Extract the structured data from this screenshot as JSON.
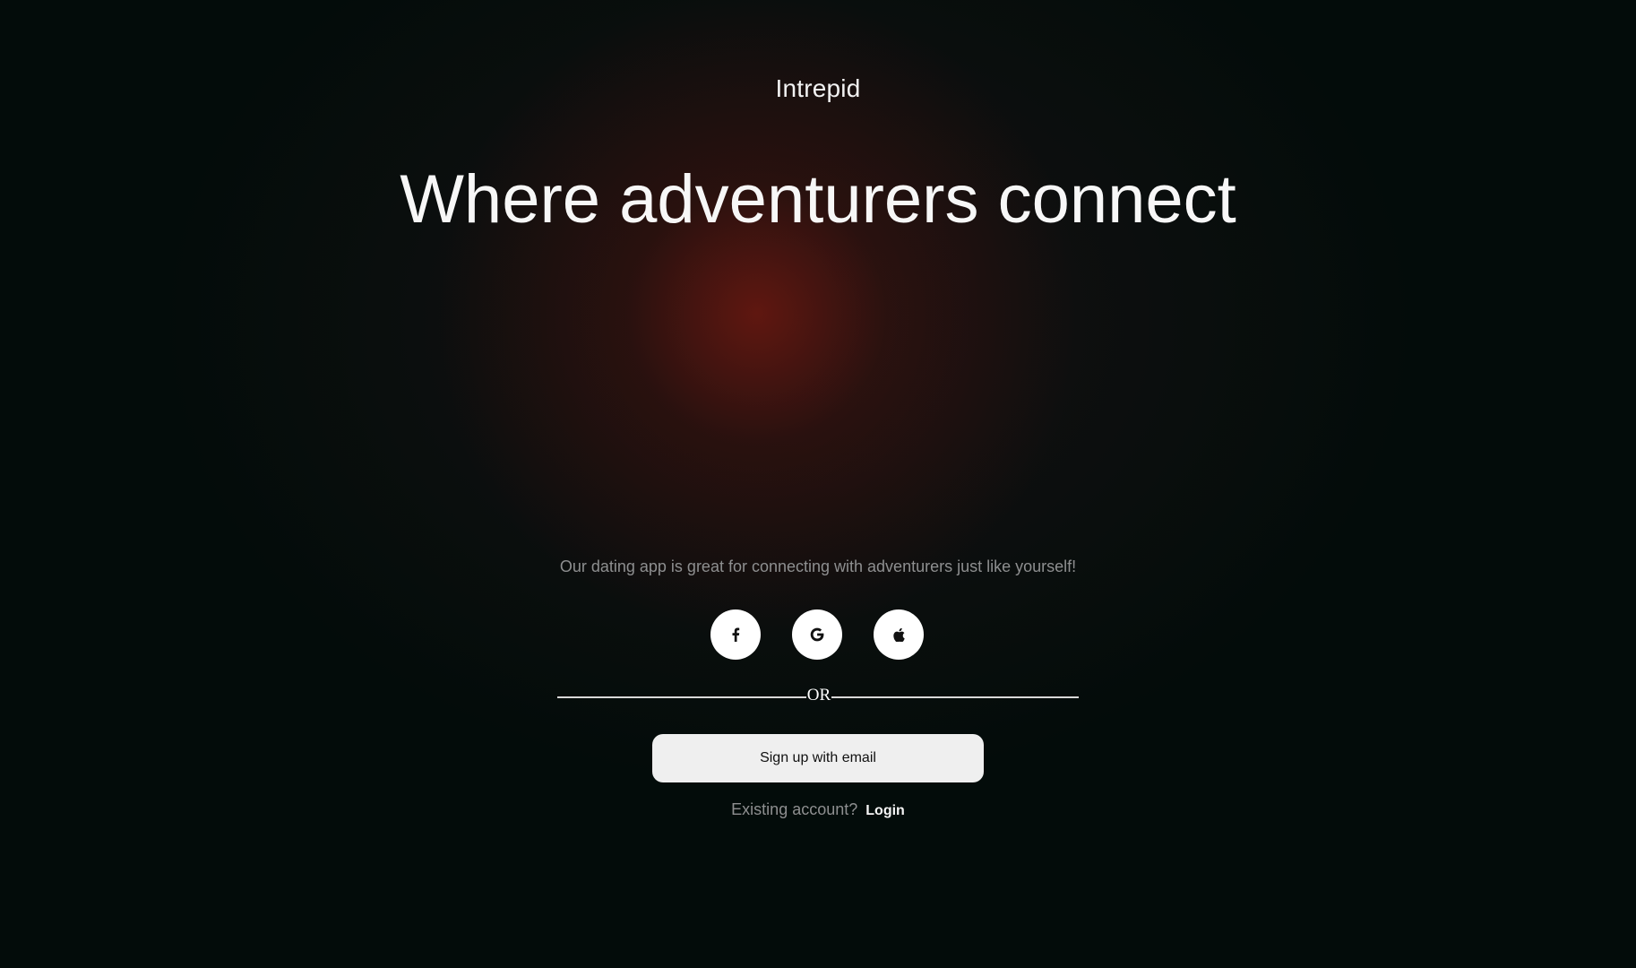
{
  "brand": {
    "name": "Intrepid"
  },
  "hero": {
    "headline": "Where adventurers connect",
    "tagline": "Our dating app is great for connecting with adventurers just like yourself!"
  },
  "social_login": {
    "buttons": [
      {
        "provider": "facebook",
        "icon": "facebook-icon"
      },
      {
        "provider": "google",
        "icon": "google-icon"
      },
      {
        "provider": "apple",
        "icon": "apple-icon"
      }
    ]
  },
  "divider": {
    "label": "OR"
  },
  "signup": {
    "label": "Sign up with email"
  },
  "login_prompt": {
    "text": "Existing account?",
    "link_label": "Login"
  },
  "colors": {
    "background": "#030c0a",
    "glow": "#6e1a10",
    "button_bg": "#efefef",
    "muted_text": "#8e8f90"
  }
}
